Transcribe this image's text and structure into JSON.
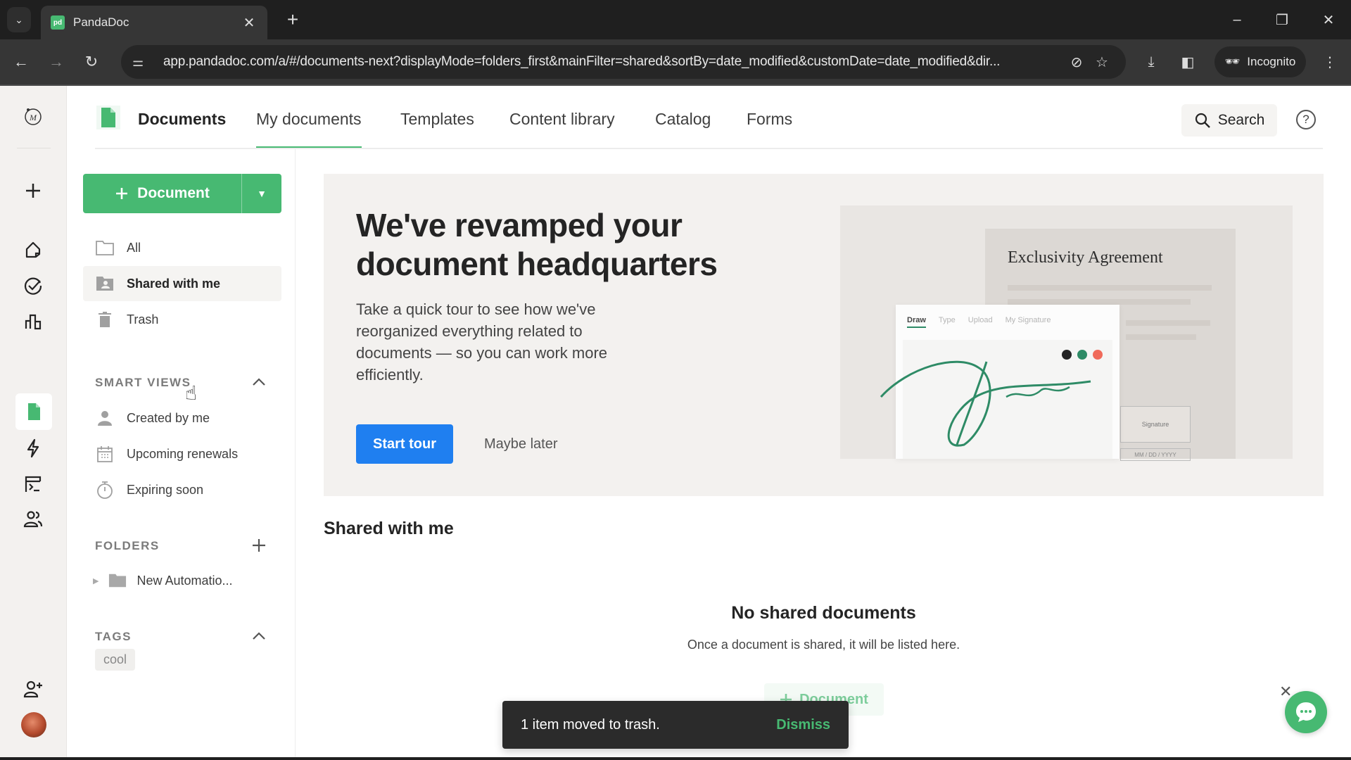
{
  "browser": {
    "tab_title": "PandaDoc",
    "tab_favicon_text": "pd",
    "url": "app.pandadoc.com/a/#/documents-next?displayMode=folders_first&mainFilter=shared&sortBy=date_modified&customDate=date_modified&dir...",
    "incognito_label": "Incognito"
  },
  "topnav": {
    "section_title": "Documents",
    "tabs": [
      {
        "label": "My documents",
        "active": true
      },
      {
        "label": "Templates"
      },
      {
        "label": "Content library"
      },
      {
        "label": "Catalog"
      },
      {
        "label": "Forms"
      }
    ],
    "search_label": "Search",
    "help_label": "?"
  },
  "leftpanel": {
    "new_document_label": "Document",
    "main_items": [
      {
        "label": "All",
        "icon": "folder-icon"
      },
      {
        "label": "Shared with me",
        "icon": "shared-folder-icon",
        "active": true
      },
      {
        "label": "Trash",
        "icon": "trash-icon"
      }
    ],
    "smart_views": {
      "header": "SMART VIEWS",
      "items": [
        {
          "label": "Created by me",
          "icon": "person-icon"
        },
        {
          "label": "Upcoming renewals",
          "icon": "calendar-icon"
        },
        {
          "label": "Expiring soon",
          "icon": "stopwatch-icon"
        }
      ]
    },
    "folders": {
      "header": "FOLDERS",
      "items": [
        {
          "label": "New Automatio..."
        }
      ]
    },
    "tags": {
      "header": "TAGS",
      "items": [
        {
          "label": "cool"
        }
      ]
    }
  },
  "promo": {
    "title_line1": "We've revamped your",
    "title_line2": "document headquarters",
    "description": "Take a quick tour to see how we've reorganized everything related to documents — so you can work more efficiently.",
    "start_label": "Start tour",
    "later_label": "Maybe later",
    "illustration": {
      "doc_title": "Exclusivity Agreement",
      "pad_tabs": [
        "Draw",
        "Type",
        "Upload",
        "My Signature"
      ],
      "signature_field": "Signature",
      "date_field": "MM / DD / YYYY",
      "swatch_colors": [
        "#242424",
        "#2e8b66",
        "#f06a5a"
      ]
    }
  },
  "shared": {
    "title": "Shared with me",
    "empty_title": "No shared documents",
    "empty_subtitle": "Once a document is shared, it will be listed here.",
    "empty_button_label": "Document"
  },
  "toast": {
    "message": "1 item moved to trash.",
    "action_label": "Dismiss"
  },
  "colors": {
    "brand_green": "#47b972",
    "primary_blue": "#1f7ff0"
  }
}
